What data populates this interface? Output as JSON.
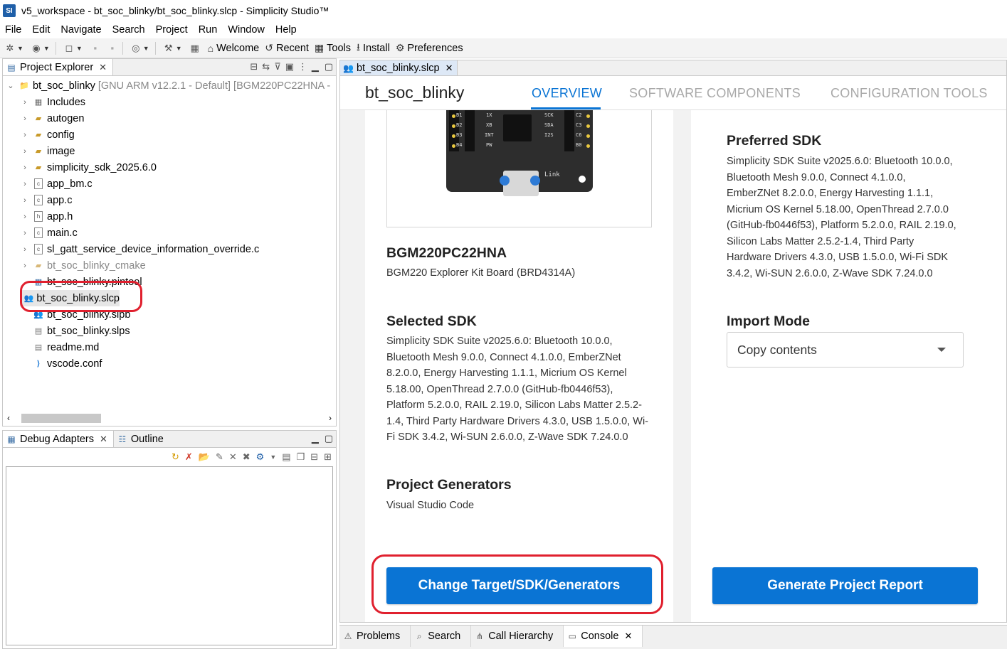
{
  "window": {
    "title": "v5_workspace - bt_soc_blinky/bt_soc_blinky.slcp - Simplicity Studio™",
    "app_icon": "SI"
  },
  "menu": [
    "File",
    "Edit",
    "Navigate",
    "Search",
    "Project",
    "Run",
    "Window",
    "Help"
  ],
  "toolbar": {
    "welcome": "Welcome",
    "recent": "Recent",
    "tools": "Tools",
    "install": "Install",
    "preferences": "Preferences"
  },
  "project_explorer": {
    "tab_label": "Project Explorer",
    "root": {
      "name": "bt_soc_blinky",
      "detail": "[GNU ARM v12.2.1 - Default] [BGM220PC22HNA -"
    },
    "items": [
      {
        "label": "Includes",
        "kind": "includes"
      },
      {
        "label": "autogen",
        "kind": "folder"
      },
      {
        "label": "config",
        "kind": "folder"
      },
      {
        "label": "image",
        "kind": "folder"
      },
      {
        "label": "simplicity_sdk_2025.6.0",
        "kind": "folder"
      },
      {
        "label": "app_bm.c",
        "kind": "c"
      },
      {
        "label": "app.c",
        "kind": "c"
      },
      {
        "label": "app.h",
        "kind": "h"
      },
      {
        "label": "main.c",
        "kind": "c"
      },
      {
        "label": "sl_gatt_service_device_information_override.c",
        "kind": "c"
      },
      {
        "label": "bt_soc_blinky_cmake",
        "kind": "folder-muted"
      },
      {
        "label": "bt_soc_blinky.pintool",
        "kind": "pin"
      },
      {
        "label": "bt_soc_blinky.slcp",
        "kind": "slcp"
      },
      {
        "label": "bt_soc_blinky.slpb",
        "kind": "slpb"
      },
      {
        "label": "bt_soc_blinky.slps",
        "kind": "doc"
      },
      {
        "label": "readme.md",
        "kind": "doc"
      },
      {
        "label": "vscode.conf",
        "kind": "vscode"
      }
    ]
  },
  "debug_panel": {
    "tab_debug": "Debug Adapters",
    "tab_outline": "Outline"
  },
  "editor": {
    "tab_label": "bt_soc_blinky.slcp",
    "title": "bt_soc_blinky",
    "nav": [
      "OVERVIEW",
      "SOFTWARE COMPONENTS",
      "CONFIGURATION TOOLS"
    ],
    "target": {
      "heading": "BGM220PC22HNA",
      "board": "BGM220 Explorer Kit Board (BRD4314A)"
    },
    "selected_sdk": {
      "heading": "Selected SDK",
      "lines": [
        "Simplicity SDK Suite v2025.6.0: Bluetooth 10.0.0,",
        "Bluetooth Mesh 9.0.0, Connect 4.1.0.0, EmberZNet",
        "8.2.0.0, Energy Harvesting 1.1.1, Micrium OS Kernel",
        "5.18.00, OpenThread 2.7.0.0 (GitHub-fb0446f53),",
        "Platform 5.2.0.0, RAIL 2.19.0, Silicon Labs Matter 2.5.2-",
        "1.4, Third Party Hardware Drivers 4.3.0, USB 1.5.0.0, Wi-",
        "Fi SDK 3.4.2, Wi-SUN 2.6.0.0, Z-Wave SDK 7.24.0.0"
      ]
    },
    "project_generators": {
      "heading": "Project Generators",
      "value": "Visual Studio Code"
    },
    "change_button": "Change Target/SDK/Generators",
    "preferred_sdk": {
      "heading": "Preferred SDK",
      "lines": [
        "Simplicity SDK Suite v2025.6.0: Bluetooth 10.0.0,",
        "Bluetooth Mesh 9.0.0, Connect 4.1.0.0,",
        "EmberZNet 8.2.0.0, Energy Harvesting 1.1.1,",
        "Micrium OS Kernel 5.18.00, OpenThread 2.7.0.0",
        "(GitHub-fb0446f53), Platform 5.2.0.0, RAIL 2.19.0,",
        "Silicon Labs Matter 2.5.2-1.4, Third Party",
        "Hardware Drivers 4.3.0, USB 1.5.0.0, Wi-Fi SDK",
        "3.4.2, Wi-SUN 2.6.0.0, Z-Wave SDK 7.24.0.0"
      ]
    },
    "import_mode": {
      "heading": "Import Mode",
      "value": "Copy contents"
    },
    "report_button": "Generate Project Report",
    "board_silkscreen": [
      "B1",
      "B2",
      "B3",
      "B4",
      "C2",
      "C3",
      "C6",
      "B0",
      "1X",
      "XB",
      "INT",
      "PW",
      "SCK",
      "SDA",
      "I2S",
      "Link"
    ]
  },
  "bottom_tabs": [
    "Problems",
    "Search",
    "Call Hierarchy",
    "Console"
  ],
  "colors": {
    "accent": "#0a74d4",
    "highlight": "#e0202e"
  }
}
